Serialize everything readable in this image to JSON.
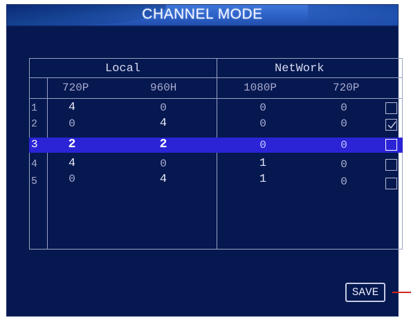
{
  "window": {
    "title": "CHANNEL MODE"
  },
  "table": {
    "groups": [
      "Local",
      "NetWork"
    ],
    "columns": [
      "720P",
      "960H",
      "1080P",
      "720P"
    ],
    "rows": [
      {
        "num": "1",
        "values": [
          "4",
          "0",
          "0",
          "0"
        ],
        "checked": false,
        "selected": false
      },
      {
        "num": "2",
        "values": [
          "0",
          "4",
          "0",
          "0"
        ],
        "checked": true,
        "selected": false
      },
      {
        "num": "3",
        "values": [
          "2",
          "2",
          "0",
          "0"
        ],
        "checked": false,
        "selected": true
      },
      {
        "num": "4",
        "values": [
          "4",
          "0",
          "1",
          "0"
        ],
        "checked": false,
        "selected": false
      },
      {
        "num": "5",
        "values": [
          "0",
          "4",
          "1",
          "0"
        ],
        "checked": false,
        "selected": false
      }
    ]
  },
  "actions": {
    "save_label": "SAVE"
  },
  "colors": {
    "background": "#05184f",
    "title_bar": "#2f64c8",
    "highlight": "#2b24d6",
    "grid_lines": "#9aa3c4",
    "pointer": "#d3241c"
  }
}
